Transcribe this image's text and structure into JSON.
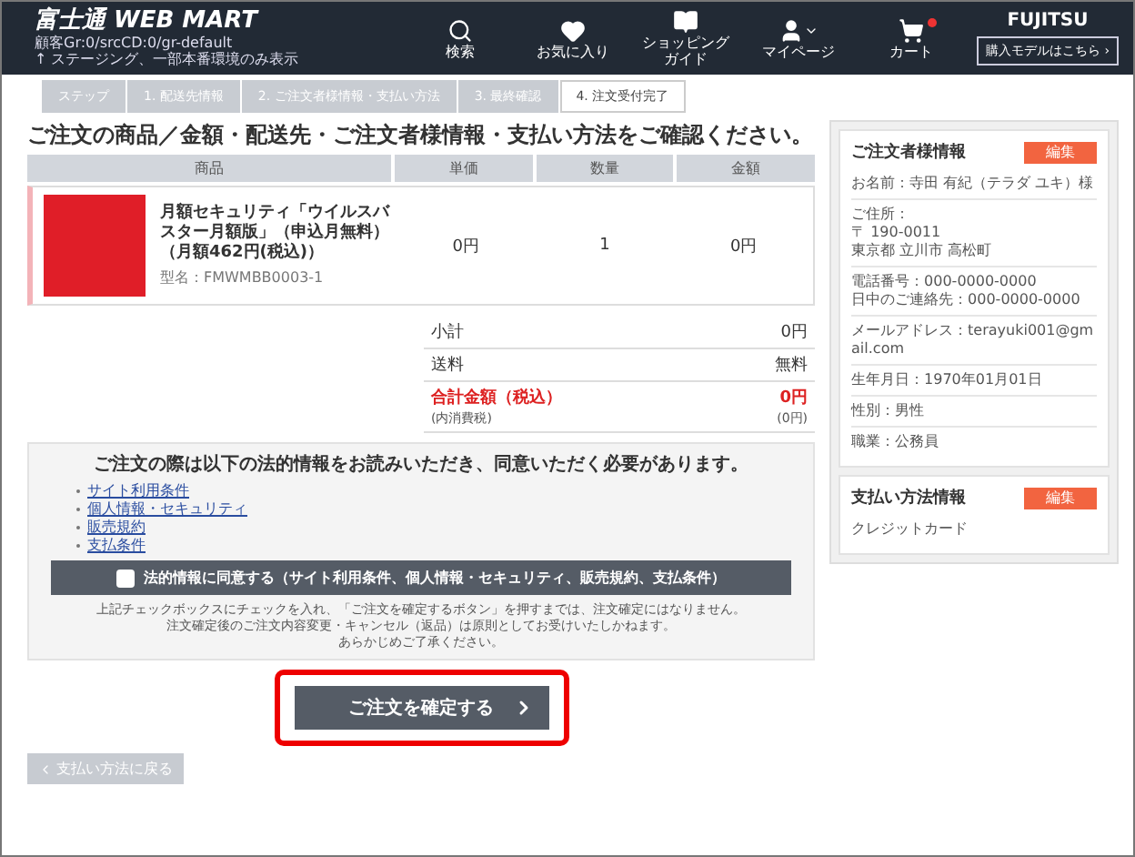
{
  "header": {
    "logo": "富士通 WEB MART",
    "info_lines": [
      "顧客Gr:0/srcCD:0/gr-default",
      "↑ ステージング、一部本番環境のみ表示"
    ],
    "nav": [
      {
        "kind": "search",
        "label": "検索"
      },
      {
        "kind": "heart",
        "label": "お気に入り"
      },
      {
        "kind": "guide",
        "label": "ショッピングガイド"
      },
      {
        "kind": "user",
        "label": "マイページ"
      },
      {
        "kind": "cart",
        "label": "カート",
        "badge": true
      }
    ],
    "brand": "FUJITSU",
    "model_button": "購入モデルはこちら ›"
  },
  "steps": [
    {
      "label": "ステップ",
      "selected": false
    },
    {
      "label": "1. 配送先情報",
      "selected": false
    },
    {
      "label": "2. ご注文者様情報・支払い方法",
      "selected": false
    },
    {
      "label": "3. 最終確認",
      "selected": false
    },
    {
      "label": "4. 注文受付完了",
      "selected": true
    }
  ],
  "title": "ご注文の商品／金額・配送先・ご注文者様情報・支払い方法をご確認ください。",
  "table": {
    "columns": [
      "商品",
      "単価",
      "数量",
      "金額"
    ],
    "rows": [
      {
        "name": "月額セキュリティ「ウイルスバスター月額版」（申込月無料）（月額462円(税込)）",
        "model": "型名：FMWMBB0003-1",
        "unit_price": "0円",
        "quantity": "1",
        "amount": "0円"
      }
    ]
  },
  "summary": [
    {
      "label": "小計",
      "value": "0円",
      "total": false
    },
    {
      "label": "送料",
      "value": "無料",
      "total": false
    },
    {
      "label": "合計金額（税込）",
      "value": "0円",
      "note_label": "(内消費税)",
      "note_value": "(0円)",
      "total": true
    }
  ],
  "legal": {
    "heading": "ご注文の際は以下の法的情報をお読みいただき、同意いただく必要があります。",
    "links": [
      "サイト利用条件",
      "個人情報・セキュリティ",
      "販売規約",
      "支払条件"
    ],
    "agree": {
      "label": "法的情報に同意する（サイト利用条件、個人情報・セキュリティ、販売規約、支払条件）",
      "checked": false
    },
    "notes": [
      "上記チェックボックスにチェックを入れ、「ご注文を確定するボタン」を押すまでは、注文確定にはなりません。",
      "注文確定後のご注文内容変更・キャンセル（返品）は原則としてお受けいたしかねます。",
      "あらかじめご了承ください。"
    ]
  },
  "confirm_button": "ご注文を確定する",
  "back_button": "支払い方法に戻る",
  "sidebar": [
    {
      "title": "ご注文者様情報",
      "edit": "編集",
      "sections": [
        [
          "お名前：寺田 有紀（テラダ ユキ）様"
        ],
        [
          "ご住所：",
          "〒 190-0011",
          "東京都 立川市 高松町"
        ],
        [
          "電話番号：000-0000-0000",
          "日中のご連絡先：000-0000-0000"
        ],
        [
          "メールアドレス：terayuki001@gmail.com"
        ],
        [
          "生年月日：1970年01月01日"
        ],
        [
          "性別：男性"
        ],
        [
          "職業：公務員"
        ]
      ]
    },
    {
      "title": "支払い方法情報",
      "edit": "編集",
      "sections": [
        [
          "クレジットカード"
        ]
      ]
    }
  ]
}
